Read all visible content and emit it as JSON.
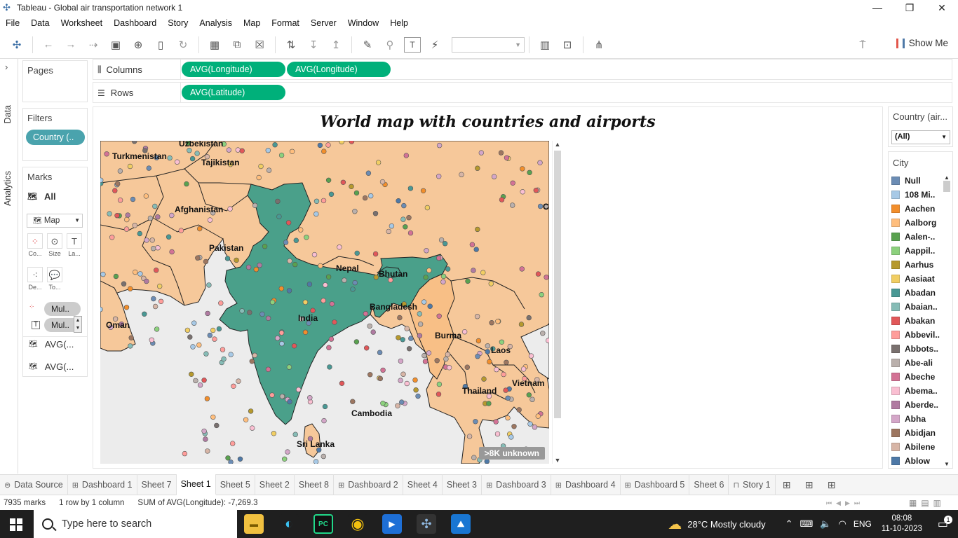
{
  "window": {
    "title": "Tableau - Global air transportation network 1",
    "minimize": "—",
    "restore": "❐",
    "close": "✕"
  },
  "menu": [
    "File",
    "Data",
    "Worksheet",
    "Dashboard",
    "Story",
    "Analysis",
    "Map",
    "Format",
    "Server",
    "Window",
    "Help"
  ],
  "toolbar": {
    "show_me": "Show Me"
  },
  "side_tabs": {
    "data": "Data",
    "analytics": "Analytics"
  },
  "pages": {
    "title": "Pages"
  },
  "filters": {
    "title": "Filters",
    "pill": "Country (.."
  },
  "marks": {
    "title": "Marks",
    "all": "All",
    "type": "Map",
    "buttons": [
      {
        "label": "Co...",
        "icon": "color-icon"
      },
      {
        "label": "Size",
        "icon": "size-icon"
      },
      {
        "label": "La...",
        "icon": "label-icon"
      },
      {
        "label": "De...",
        "icon": "detail-icon"
      },
      {
        "label": "To...",
        "icon": "tooltip-icon"
      }
    ],
    "pills": [
      "Mul..",
      "Mul.."
    ],
    "layers": [
      "AVG(...",
      "AVG(..."
    ]
  },
  "shelves": {
    "columns_label": "Columns",
    "columns": [
      "AVG(Longitude)",
      "AVG(Longitude)"
    ],
    "rows_label": "Rows",
    "rows": [
      "AVG(Latitude)"
    ]
  },
  "viz": {
    "title": "World map with countries and airports",
    "unknown": ">8K unknown",
    "labels": {
      "uzbekistan": "Uzbekistan",
      "turkmenistan": "Turkmenistan",
      "tajikistan": "Tajikistan",
      "afghanistan": "Afghanistan",
      "pakistan": "Pakistan",
      "nepal": "Nepal",
      "bhutan": "Bhutan",
      "india": "India",
      "bangladesh": "Bangladesh",
      "oman": "Oman",
      "burma": "Burma",
      "laos": "Laos",
      "thailand": "Thailand",
      "vietnam": "Vietnam",
      "cambodia": "Cambodia",
      "srilanka": "Sri Lanka",
      "china": "C"
    },
    "colors": {
      "highlight": "#4aa08a",
      "other": "#f6c89a",
      "water": "#ececec"
    }
  },
  "country_filter": {
    "title": "Country (air...",
    "value": "(All)"
  },
  "legend": {
    "title": "City",
    "items": [
      {
        "name": "Null",
        "color": "#6b8cb4"
      },
      {
        "name": "108 Mi..",
        "color": "#a7c9e6"
      },
      {
        "name": "Aachen",
        "color": "#f28e2b"
      },
      {
        "name": "Aalborg",
        "color": "#ffbe7d"
      },
      {
        "name": "Aalen-..",
        "color": "#59a14f"
      },
      {
        "name": "Aappil..",
        "color": "#8cd17d"
      },
      {
        "name": "Aarhus",
        "color": "#b6992d"
      },
      {
        "name": "Aasiaat",
        "color": "#f1ce63"
      },
      {
        "name": "Abadan",
        "color": "#499894"
      },
      {
        "name": "Abaian..",
        "color": "#86bcb6"
      },
      {
        "name": "Abakan",
        "color": "#e15759"
      },
      {
        "name": "Abbevil..",
        "color": "#ff9d9a"
      },
      {
        "name": "Abbots..",
        "color": "#79706e"
      },
      {
        "name": "Abe-ali",
        "color": "#bab0ac"
      },
      {
        "name": "Abeche",
        "color": "#d37295"
      },
      {
        "name": "Abema..",
        "color": "#fabfd2"
      },
      {
        "name": "Aberde..",
        "color": "#b07aa1"
      },
      {
        "name": "Abha",
        "color": "#d4a6c8"
      },
      {
        "name": "Abidjan",
        "color": "#9d7660"
      },
      {
        "name": "Abilene",
        "color": "#d7b5a6"
      },
      {
        "name": "Ablow",
        "color": "#4e79a7"
      }
    ]
  },
  "tabs": [
    {
      "label": "Data Source",
      "icon": "datasource-icon"
    },
    {
      "label": "Dashboard 1",
      "icon": "dashboard-icon"
    },
    {
      "label": "Sheet 7"
    },
    {
      "label": "Sheet 1",
      "active": true
    },
    {
      "label": "Sheet 5"
    },
    {
      "label": "Sheet 2"
    },
    {
      "label": "Sheet 8"
    },
    {
      "label": "Dashboard 2",
      "icon": "dashboard-icon"
    },
    {
      "label": "Sheet 4"
    },
    {
      "label": "Sheet 3"
    },
    {
      "label": "Dashboard 3",
      "icon": "dashboard-icon"
    },
    {
      "label": "Dashboard 4",
      "icon": "dashboard-icon"
    },
    {
      "label": "Dashboard 5",
      "icon": "dashboard-icon"
    },
    {
      "label": "Sheet 6"
    },
    {
      "label": "Story 1",
      "icon": "story-icon"
    }
  ],
  "status": {
    "marks": "7935 marks",
    "dims": "1 row by 1 column",
    "sum": "SUM of AVG(Longitude): -7,269.3"
  },
  "taskbar": {
    "search": "Type here to search",
    "weather": "28°C  Mostly cloudy",
    "lang": "ENG",
    "time": "08:08",
    "date": "11-10-2023",
    "notif": "1"
  }
}
